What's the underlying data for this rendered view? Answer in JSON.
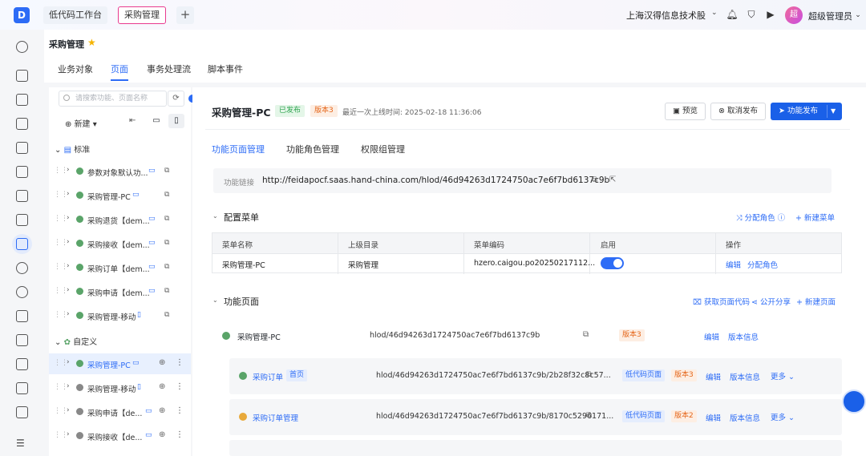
{
  "topbar": {
    "tabs": [
      "低代码工作台",
      "采购管理"
    ],
    "company": "上海汉得信息技术股",
    "user": "超级管理员",
    "avatar_text": "超"
  },
  "header": {
    "title": "采购管理",
    "tabs": [
      "业务对象",
      "页面",
      "事务处理流",
      "脚本事件"
    ]
  },
  "left": {
    "search_placeholder": "请搜索功能、页面名称",
    "new_label": "新建",
    "groups": [
      "标准",
      "自定义"
    ],
    "standard_items": [
      "参数对象默认功...",
      "采购管理-PC",
      "采购退货【dem...",
      "采购接收【dem...",
      "采购订单【dem...",
      "采购申请【dem...",
      "采购管理-移动"
    ],
    "custom_items": [
      "采购管理-PC",
      "采购管理-移动",
      "采购申请【de...",
      "采购接收【de..."
    ]
  },
  "detail": {
    "title": "采购管理-PC",
    "status": "已发布",
    "version": "版本3",
    "last_online": "最近一次上线时间: 2025-02-18 11:36:06",
    "buttons": {
      "preview": "预览",
      "cancel_publish": "取消发布",
      "publish": "功能发布"
    },
    "subtabs": [
      "功能页面管理",
      "功能角色管理",
      "权限组管理"
    ],
    "link_label": "功能链接",
    "link": "http://feidapocf.saas.hand-china.com/hlod/46d94263d1724750ac7e6f7bd6137c9b"
  },
  "menu_section": {
    "title": "配置菜单",
    "assign_role": "分配角色",
    "new_menu": "新建菜单",
    "columns": [
      "菜单名称",
      "上级目录",
      "菜单编码",
      "启用",
      "操作"
    ],
    "row": {
      "name": "采购管理-PC",
      "parent": "采购管理",
      "code": "hzero.caigou.po20250217112...",
      "enabled": true,
      "actions": [
        "编辑",
        "分配角色"
      ]
    }
  },
  "page_section": {
    "title": "功能页面",
    "get_code": "获取页面代码",
    "share": "公开分享",
    "new_page": "新建页面",
    "root": {
      "name": "采购管理-PC",
      "path": "hlod/46d94263d1724750ac7e6f7bd6137c9b",
      "version": "版本3",
      "actions": [
        "编辑",
        "版本信息"
      ]
    },
    "children": [
      {
        "name": "采购订单",
        "badge": "首页",
        "path": "hlod/46d94263d1724750ac7e6f7bd6137c9b/2b28f32c8c57...",
        "type": "低代码页面",
        "version": "版本3",
        "actions": [
          "编辑",
          "版本信息",
          "更多"
        ]
      },
      {
        "name": "采购订单管理",
        "path": "hlod/46d94263d1724750ac7e6f7bd6137c9b/8170c5296171...",
        "type": "低代码页面",
        "version": "版本2",
        "actions": [
          "编辑",
          "版本信息",
          "更多"
        ]
      }
    ]
  },
  "colors": {
    "accent": "#2d6cf6",
    "primary_button": "#1a60e8",
    "published": "#2ea44f",
    "version": "#e5661a"
  }
}
